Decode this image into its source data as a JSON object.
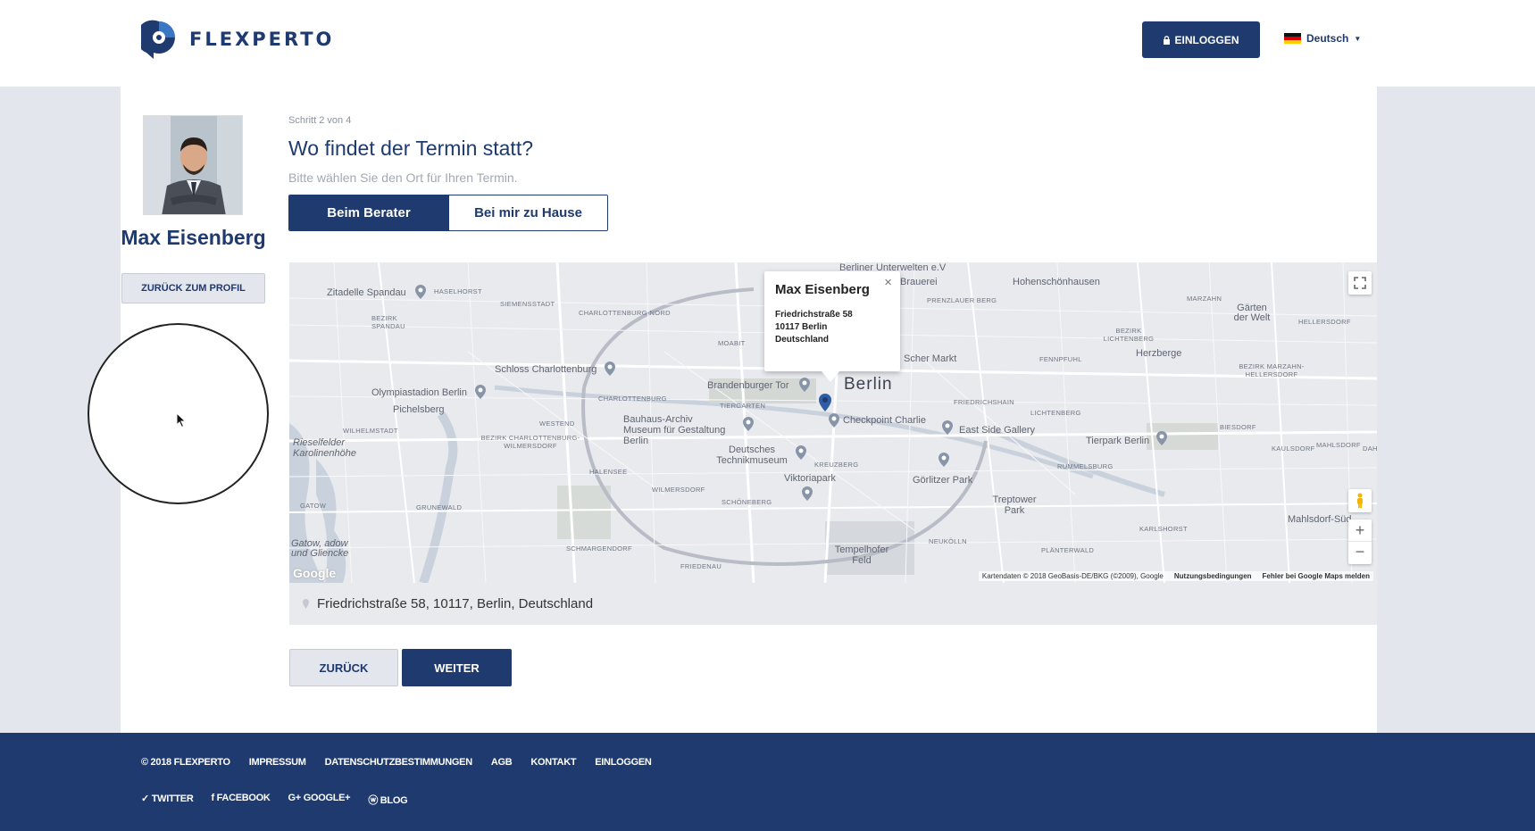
{
  "header": {
    "brand": "FLEXPERTO",
    "login_label": "EINLOGGEN",
    "language": "Deutsch"
  },
  "sidebar": {
    "advisor_name": "Max Eisenberg",
    "back_to_profile_label": "ZURÜCK ZUM PROFIL"
  },
  "main": {
    "step": "Schritt 2 von 4",
    "question": "Wo findet der Termin statt?",
    "hint": "Bitte wählen Sie den Ort für Ihren Termin.",
    "location_options": [
      {
        "label": "Beim Berater",
        "selected": true
      },
      {
        "label": "Bei mir zu Hause",
        "selected": false
      }
    ],
    "address": "Friedrichstraße 58, 10117, Berlin, Deutschland",
    "back_label": "ZURÜCK",
    "next_label": "WEITER"
  },
  "map": {
    "city_label": "Berlin",
    "popup": {
      "title": "Max Eisenberg",
      "line1": "Friedrichstraße 58",
      "line2": "10117 Berlin",
      "line3": "Deutschland"
    },
    "places": [
      "Zitadelle Spandau",
      "HASELHORST",
      "SIEMENSSTADT",
      "CHARLOTTENBURG-NORD",
      "Berliner Unterwelten e.V",
      "Brauerei",
      "PRENZLAUER BERG",
      "Hohenschönhausen",
      "Gärten der Welt",
      "MARZAHN",
      "HELLERSDORF",
      "BEZIRK SPANDAU",
      "MOABIT",
      "Schloss Charlottenburg",
      "Brandenburger Tor",
      "Olympiastadion Berlin",
      "Pichelsberg",
      "CHARLOTTENBURG",
      "TIERGARTEN",
      "Checkpoint Charlie",
      "East Side Gallery",
      "Herzberge",
      "FENNPFUHL",
      "BEZIRK LICHTENBERG",
      "BEZIRK MARZAHN-HELLERSDORF",
      "WILHELMSTADT",
      "WESTEND",
      "Bauhaus-Archiv Museum für Gestaltung Berlin",
      "BEZIRK CHARLOTTENBURG-WILMERSDORF",
      "Deutsches Technikmuseum",
      "KREUZBERG",
      "Viktoriapark",
      "Görlitzer Park",
      "LICHTENBERG",
      "FRIEDRICHSHAIN",
      "RUMMELSBURG",
      "Tierpark Berlin",
      "BIESDORF",
      "KAULSDORF",
      "MAHLSDORF",
      "Rieselfelder Karolinenhöhe",
      "HALENSEE",
      "WILMERSDORF",
      "SCHÖNEBERG",
      "Treptower Park",
      "KARLSHORST",
      "Mahlsdorf-Süd",
      "GATOW",
      "GRUNEWALD",
      "Gatow, adow und Gliencke",
      "SCHMARGENDORF",
      "FRIEDENAU",
      "Tempelhofer Feld",
      "NEUKÖLLN",
      "PLÄNTERWALD",
      "Scher Markt",
      "DAH"
    ],
    "attribution": "Kartendaten © 2018 GeoBasis-DE/BKG (©2009), Google",
    "terms": "Nutzungsbedingungen",
    "report": "Fehler bei Google Maps melden",
    "google_logo": "Google"
  },
  "footer": {
    "links": [
      "© 2018 FLEXPERTO",
      "IMPRESSUM",
      "DATENSCHUTZBESTIMMUNGEN",
      "AGB",
      "KONTAKT",
      "EINLOGGEN"
    ],
    "social": [
      "TWITTER",
      "FACEBOOK",
      "GOOGLE+",
      "BLOG"
    ]
  },
  "colors": {
    "primary": "#1f3a6e",
    "background_band": "#e4e6ee",
    "map_pin": "#2f5da3"
  }
}
